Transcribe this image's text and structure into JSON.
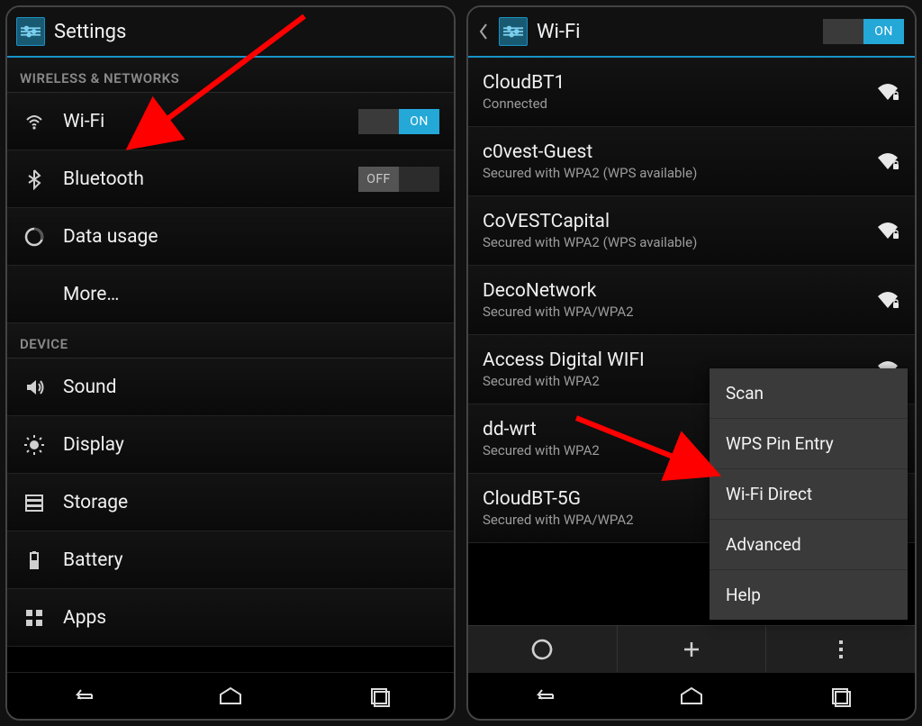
{
  "left": {
    "title": "Settings",
    "sections": [
      {
        "label": "WIRELESS & NETWORKS",
        "items": [
          {
            "name": "wifi",
            "icon": "wifi",
            "label": "Wi-Fi",
            "toggle": "ON"
          },
          {
            "name": "bluetooth",
            "icon": "bluetooth",
            "label": "Bluetooth",
            "toggle": "OFF"
          },
          {
            "name": "datausage",
            "icon": "datausage",
            "label": "Data usage"
          },
          {
            "name": "more",
            "icon": "",
            "label": "More…"
          }
        ]
      },
      {
        "label": "DEVICE",
        "items": [
          {
            "name": "sound",
            "icon": "sound",
            "label": "Sound"
          },
          {
            "name": "display",
            "icon": "display",
            "label": "Display"
          },
          {
            "name": "storage",
            "icon": "storage",
            "label": "Storage"
          },
          {
            "name": "battery",
            "icon": "battery",
            "label": "Battery"
          },
          {
            "name": "apps",
            "icon": "apps",
            "label": "Apps"
          }
        ]
      }
    ]
  },
  "right": {
    "title": "Wi-Fi",
    "toggle": "ON",
    "networks": [
      {
        "ssid": "CloudBT1",
        "sub": "Connected",
        "secure": true
      },
      {
        "ssid": "c0vest-Guest",
        "sub": "Secured with WPA2 (WPS available)",
        "secure": true
      },
      {
        "ssid": "CoVESTCapital",
        "sub": "Secured with WPA2 (WPS available)",
        "secure": true
      },
      {
        "ssid": "DecoNetwork",
        "sub": "Secured with WPA/WPA2",
        "secure": true
      },
      {
        "ssid": "Access Digital WIFI",
        "sub": "Secured with WPA2",
        "secure": true
      },
      {
        "ssid": "dd-wrt",
        "sub": "Secured with WPA2",
        "secure": true
      },
      {
        "ssid": "CloudBT-5G",
        "sub": "Secured with WPA/WPA2",
        "secure": true
      }
    ],
    "menu": [
      "Scan",
      "WPS Pin Entry",
      "Wi-Fi Direct",
      "Advanced",
      "Help"
    ]
  },
  "toggle_labels": {
    "on": "ON",
    "off": "OFF"
  }
}
